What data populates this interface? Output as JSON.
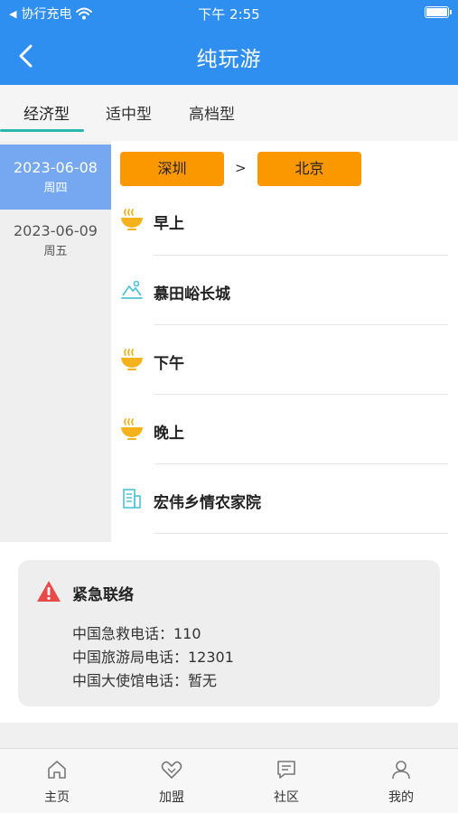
{
  "status": {
    "carrier": "协行充电",
    "time": "下午 2:55"
  },
  "header": {
    "title": "纯玩游"
  },
  "tabs": [
    {
      "label": "经济型",
      "active": true
    },
    {
      "label": "适中型",
      "active": false
    },
    {
      "label": "高档型",
      "active": false
    }
  ],
  "dates": [
    {
      "date": "2023-06-08",
      "weekday": "周四",
      "active": true
    },
    {
      "date": "2023-06-09",
      "weekday": "周五",
      "active": false
    }
  ],
  "route": {
    "from": "深圳",
    "separator": ">",
    "to": "北京"
  },
  "itinerary": [
    {
      "label": "早上",
      "icon": "meal-bowl-icon"
    },
    {
      "label": "慕田峪长城",
      "icon": "scenery-icon"
    },
    {
      "label": "下午",
      "icon": "meal-bowl-icon"
    },
    {
      "label": "晚上",
      "icon": "meal-bowl-icon"
    },
    {
      "label": "宏伟乡情农家院",
      "icon": "hotel-building-icon"
    }
  ],
  "emergency": {
    "title": "紧急联络",
    "contacts": [
      "中国急救电话：110",
      "中国旅游局电话：12301",
      "中国大使馆电话：暂无"
    ]
  },
  "bottom_nav": [
    {
      "label": "主页",
      "icon": "home-icon"
    },
    {
      "label": "加盟",
      "icon": "handshake-icon"
    },
    {
      "label": "社区",
      "icon": "chat-icon"
    },
    {
      "label": "我的",
      "icon": "user-icon"
    }
  ],
  "colors": {
    "primary": "#2f8ff0",
    "tab_indicator": "#2bb7b0",
    "date_active": "#75a8f1",
    "city_button": "#fb9800",
    "meal_icon": "#f5b21c",
    "warning": "#e84a4a"
  }
}
